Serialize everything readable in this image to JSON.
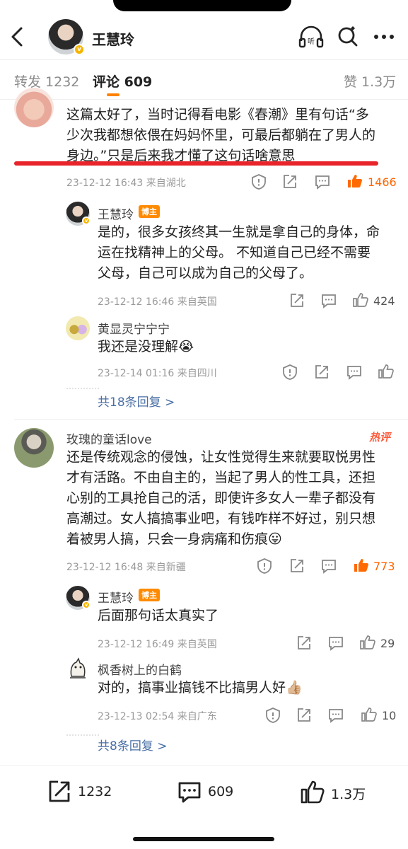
{
  "header": {
    "author": "王慧玲",
    "verified_mark": "v"
  },
  "tabs": {
    "repost": "转发 1232",
    "comments": "评论 609",
    "likes": "赞 1.3万"
  },
  "comments": [
    {
      "text_lines": [
        "这篇太好了，当时记得看电影《春潮》里有句话“多",
        "少次我都想依偎在妈妈怀里，可最后都躺在了男人的",
        "身边。”只是后来我才懂了这句话啥意思"
      ],
      "meta": "23-12-12 16:43  来自湖北",
      "likes": "1466",
      "replies": [
        {
          "name": "王慧玲",
          "badge": "博主",
          "text_lines": [
            "是的，很多女孩终其一生就是拿自己的身体，命",
            "运在找精神上的父母。 不知道自己已经不需要",
            "父母，自己可以成为自己的父母了。"
          ],
          "meta": "23-12-12 16:46  来自英国",
          "likes": "424"
        },
        {
          "name": "黄显灵宁宁宁",
          "text": "我还是没理解",
          "emoji": "😭",
          "meta": "23-12-14 01:16  来自四川"
        }
      ],
      "more_replies": "共18条回复 >"
    },
    {
      "name": "玫瑰的童话love",
      "hot_tag": "热评",
      "text_lines": [
        "还是传统观念的侵蚀，让女性觉得生来就要取悦男性",
        "才有活路。不由自主的，当起了男人的性工具，还担",
        "心别的工具抢自己的活，即使许多女人一辈子都没有",
        "高潮过。女人搞搞事业吧，有钱咋样不好过，别只想",
        "着被男人搞，只会一身病痛和伤痕"
      ],
      "emoji": "😛",
      "meta": "23-12-12 16:48  来自新疆",
      "likes": "773",
      "replies": [
        {
          "name": "王慧玲",
          "badge": "博主",
          "text": "后面那句话太真实了",
          "meta": "23-12-12 16:49  来自英国",
          "likes": "29"
        },
        {
          "name": "枫香树上的白鹤",
          "text": "对的，搞事业搞钱不比搞男人好",
          "emoji": "👍🏼",
          "meta": "23-12-13 02:54  来自广东",
          "likes": "10"
        }
      ],
      "more_replies": "共8条回复 >"
    }
  ],
  "bottom_bar": {
    "reposts": "1232",
    "comments": "609",
    "likes": "1.3万"
  },
  "colors": {
    "accent": "#ff8200",
    "hot_like": "#ff6600",
    "link": "#4a6fa5",
    "highlight_line": "#e8232a"
  }
}
